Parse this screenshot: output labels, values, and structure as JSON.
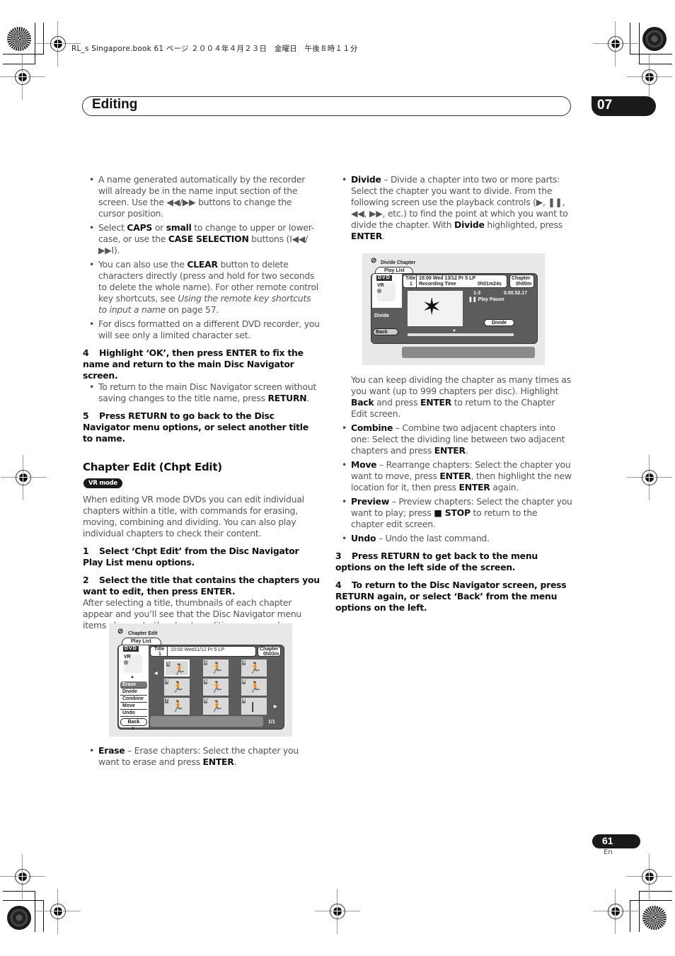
{
  "print_header": "RL_s Singapore.book  61 ページ  ２００４年４月２３日　金曜日　午後８時１１分",
  "chapter": {
    "title": "Editing",
    "number": "07"
  },
  "left_column": {
    "bullets_top": [
      [
        "A name generated automatically by the recorder will already be in the name input section of the screen. Use the ◀◀/▶▶ buttons to change the cursor position."
      ],
      {
        "pre": "Select ",
        "b1": "CAPS",
        "mid1": " or ",
        "b2": "small",
        "mid2": " to change to upper or lower-case, or use the ",
        "b3": "CASE SELECTION",
        "post": " buttons (I◀◀/ ▶▶I)."
      },
      {
        "pre": "You can also use the ",
        "b1": "CLEAR",
        "mid": " button to delete characters directly (press and hold for two seconds to delete the whole name). For other remote control key shortcuts, see ",
        "i1": "Using the remote key shortcuts to input a name",
        "post": " on page 57."
      },
      "For discs formatted on a different DVD recorder, you will see only a limited character set."
    ],
    "step4": {
      "num": "4",
      "text": "Highlight ‘OK’, then press ENTER to fix the name and return to the main Disc Navigator screen."
    },
    "step4_bullet": {
      "pre": "To return to the main Disc Navigator screen without saving changes to the title name, press ",
      "b": "RETURN",
      "post": "."
    },
    "step5": {
      "num": "5",
      "text": "Press RETURN to go back to the Disc Navigator menu options, or select another title to name."
    },
    "section_heading": "Chapter Edit (Chpt Edit)",
    "badge": "VR mode",
    "intro": "When editing VR mode DVDs you can edit individual chapters within a title, with commands for erasing, moving, combining and dividing. You can also play individual chapters to check their content.",
    "step1": {
      "num": "1",
      "text": "Select ‘Chpt Edit’ from the Disc Navigator Play List menu options."
    },
    "step2": {
      "num": "2",
      "text": "Select the title that contains the chapters you want to edit, then press ENTER."
    },
    "step2_body": "After selecting a title, thumbnails of each chapter appear and you’ll see that the Disc Navigator menu items change to the chapter editing commands:",
    "erase_bullet": {
      "b": "Erase",
      "mid": " – Erase chapters: Select the chapter you want to erase and press ",
      "b2": "ENTER",
      "post": "."
    }
  },
  "chapter_edit_screen": {
    "title": "Chapter Edit",
    "tab": "Play List",
    "disc": "DVD",
    "disc_logo": "VR",
    "title_label": "Title",
    "title_num": "1",
    "info": "15:00 Wed11/12  Pr 5   LP",
    "chapter_label": "Chapter",
    "chapter_time": "0h03m",
    "menu": [
      "Erase",
      "Divide",
      "Combine",
      "Move",
      "Undo"
    ],
    "selected_menu": "Erase",
    "back": "Back",
    "page": "1/1",
    "thumbnails": [
      "1",
      "2",
      "3",
      "4",
      "5",
      "6",
      "7",
      "8",
      "9"
    ],
    "selected_thumbnail": "1"
  },
  "right_column": {
    "divide_bullet": {
      "b": "Divide",
      "mid": " – Divide a chapter into two or more parts: Select the chapter you want to divide. From the following screen use the playback controls (▶, ❚❚, ◀◀, ▶▶, etc.) to find the point at which you want to divide the chapter. With ",
      "b2": "Divide",
      "mid2": " highlighted, press ",
      "b3": "ENTER",
      "post": "."
    },
    "after_divide": {
      "pre": "You can keep dividing the chapter as many times as you want (up to 999 chapters per disc). Highlight ",
      "b1": "Back",
      "mid": " and press ",
      "b2": "ENTER",
      "post": " to return to the Chapter Edit screen."
    },
    "combine_bullet": {
      "b": "Combine",
      "mid": " – Combine two adjacent chapters into one: Select the dividing line between two adjacent chapters and press ",
      "b2": "ENTER",
      "post": "."
    },
    "move_bullet": {
      "b": "Move",
      "mid": " – Rearrange chapters: Select the chapter you want to move, press ",
      "b2": "ENTER",
      "mid2": ", then highlight the new location for it, then press ",
      "b3": "ENTER",
      "post": " again."
    },
    "preview_bullet": {
      "b": "Preview",
      "mid": " – Preview chapters: Select the chapter you want to play; press ",
      "b2": "■ STOP",
      "post": " to return to the chapter edit screen."
    },
    "undo_bullet": {
      "b": "Undo",
      "post": " – Undo the last command."
    },
    "step3": {
      "num": "3",
      "text": "Press RETURN to get back to the menu options on the left side of the screen."
    },
    "step4": {
      "num": "4",
      "text": "To return to the Disc Navigator screen, press RETURN again, or select ‘Back’ from the menu options on the left."
    }
  },
  "divide_chapter_screen": {
    "title": "Divide Chapter",
    "tab": "Play List",
    "disc": "DVD",
    "disc_logo": "VR",
    "title_label": "Title",
    "title_num": "1",
    "info_line1": "15:00 Wed  13/12  Pr 5    LP",
    "info_line2": "Recording Time",
    "rec_time": "0h01m24s",
    "chapter_label": "Chapter",
    "chapter_time": "0h00m",
    "chapter_range": "1-3",
    "timecode": "0.00.52.17",
    "status": "❚❚ Play Pause",
    "menu_selected": "Divide",
    "back": "Back",
    "divide_button": "Divide",
    "progress_fraction": 0.42
  },
  "footer": {
    "page_number": "61",
    "lang": "En"
  }
}
